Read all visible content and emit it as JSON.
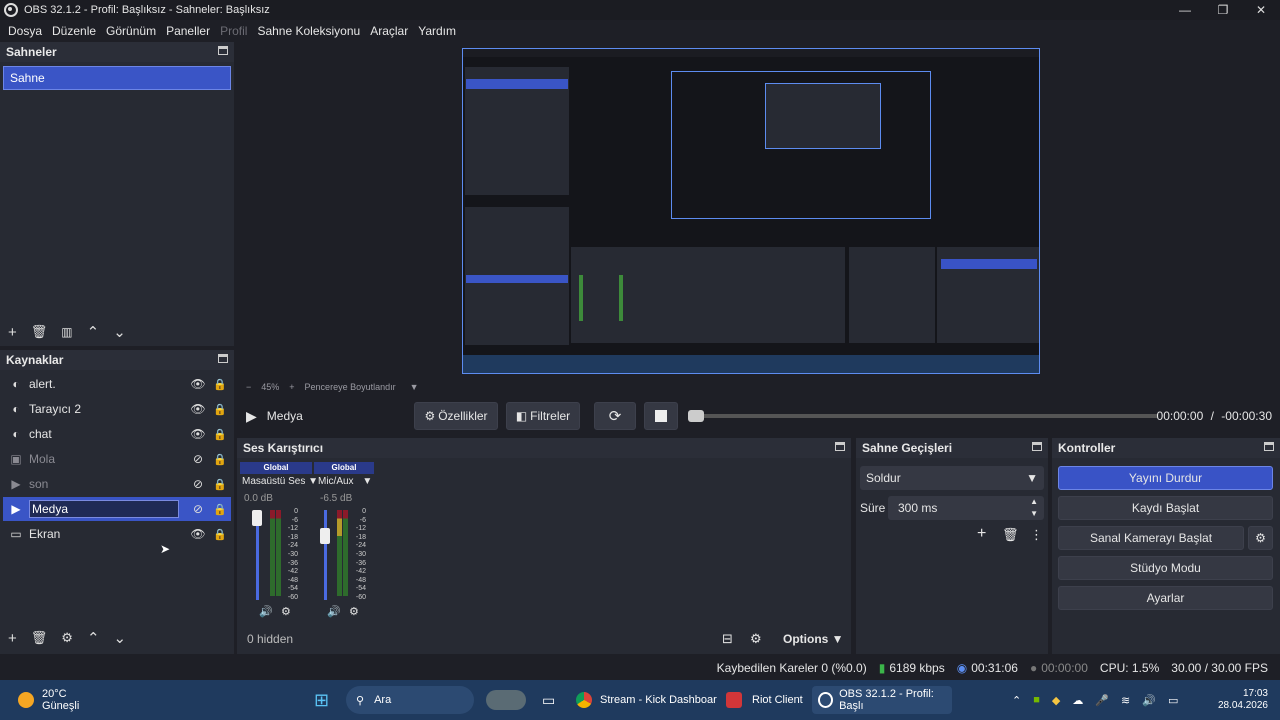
{
  "window": {
    "title": "OBS 32.1.2 - Profil: Başlıksız - Sahneler: Başlıksız"
  },
  "menu": [
    "Dosya",
    "Düzenle",
    "Görünüm",
    "Paneller",
    "Profil",
    "Sahne Koleksiyonu",
    "Araçlar",
    "Yardım"
  ],
  "scenes": {
    "title": "Sahneler",
    "items": [
      "Sahne"
    ]
  },
  "sources": {
    "title": "Kaynaklar",
    "items": [
      {
        "label": "alert.",
        "icon": "browser-icon",
        "visible": true
      },
      {
        "label": "Tarayıcı 2",
        "icon": "browser-icon",
        "visible": true
      },
      {
        "label": "chat",
        "icon": "browser-icon",
        "visible": true
      },
      {
        "label": "Mola",
        "icon": "image-icon",
        "visible": false
      },
      {
        "label": "son",
        "icon": "play-icon",
        "visible": false
      },
      {
        "label": "Medya",
        "icon": "play-icon",
        "visible": false,
        "selected": true
      },
      {
        "label": "Ekran",
        "icon": "monitor-icon",
        "visible": true
      }
    ]
  },
  "preview": {
    "zoom": "45%",
    "fit_label": "Pencereye Boyutlandır"
  },
  "media": {
    "name": "Medya",
    "properties_label": "Özellikler",
    "filters_label": "Filtreler",
    "time_current": "00:00:00",
    "time_sep": "/",
    "time_remaining": "-00:00:30"
  },
  "mixer": {
    "title": "Ses Karıştırıcı",
    "channels": [
      {
        "scope": "Global",
        "name": "Masaüstü Ses",
        "db": "0.0 dB",
        "level": 0.9
      },
      {
        "scope": "Global",
        "name": "Mic/Aux",
        "db": "-6.5 dB",
        "level": 0.7
      }
    ],
    "scale": [
      "0",
      "-6",
      "-12",
      "-18",
      "-24",
      "-30",
      "-36",
      "-42",
      "-48",
      "-54",
      "-60"
    ],
    "hidden": "0 hidden",
    "options_label": "Options"
  },
  "transitions": {
    "title": "Sahne Geçişleri",
    "selected": "Soldur",
    "duration_label": "Süre",
    "duration_value": "300 ms"
  },
  "controls": {
    "title": "Kontroller",
    "stop_stream": "Yayını Durdur",
    "start_record": "Kaydı Başlat",
    "virtual_cam": "Sanal Kamerayı Başlat",
    "studio_mode": "Stüdyo Modu",
    "settings": "Ayarlar"
  },
  "status": {
    "dropped": "Kaybedilen Kareler 0 (%0.0)",
    "bitrate": "6189 kbps",
    "stream_time": "00:31:06",
    "rec_time": "00:00:00",
    "cpu": "CPU: 1.5%",
    "fps": "30.00 / 30.00 FPS"
  },
  "taskbar": {
    "weather_temp": "20°C",
    "weather_desc": "Güneşli",
    "search": "Ara",
    "apps": [
      "Stream - Kick Dashboar",
      "Riot Client",
      "OBS 32.1.2 - Profil: Başlı"
    ],
    "clock_time": "17:03",
    "clock_date": "28.04.2026"
  },
  "colors": {
    "accent": "#3953c6",
    "bg": "#1e1f26",
    "panel": "#272a33"
  }
}
